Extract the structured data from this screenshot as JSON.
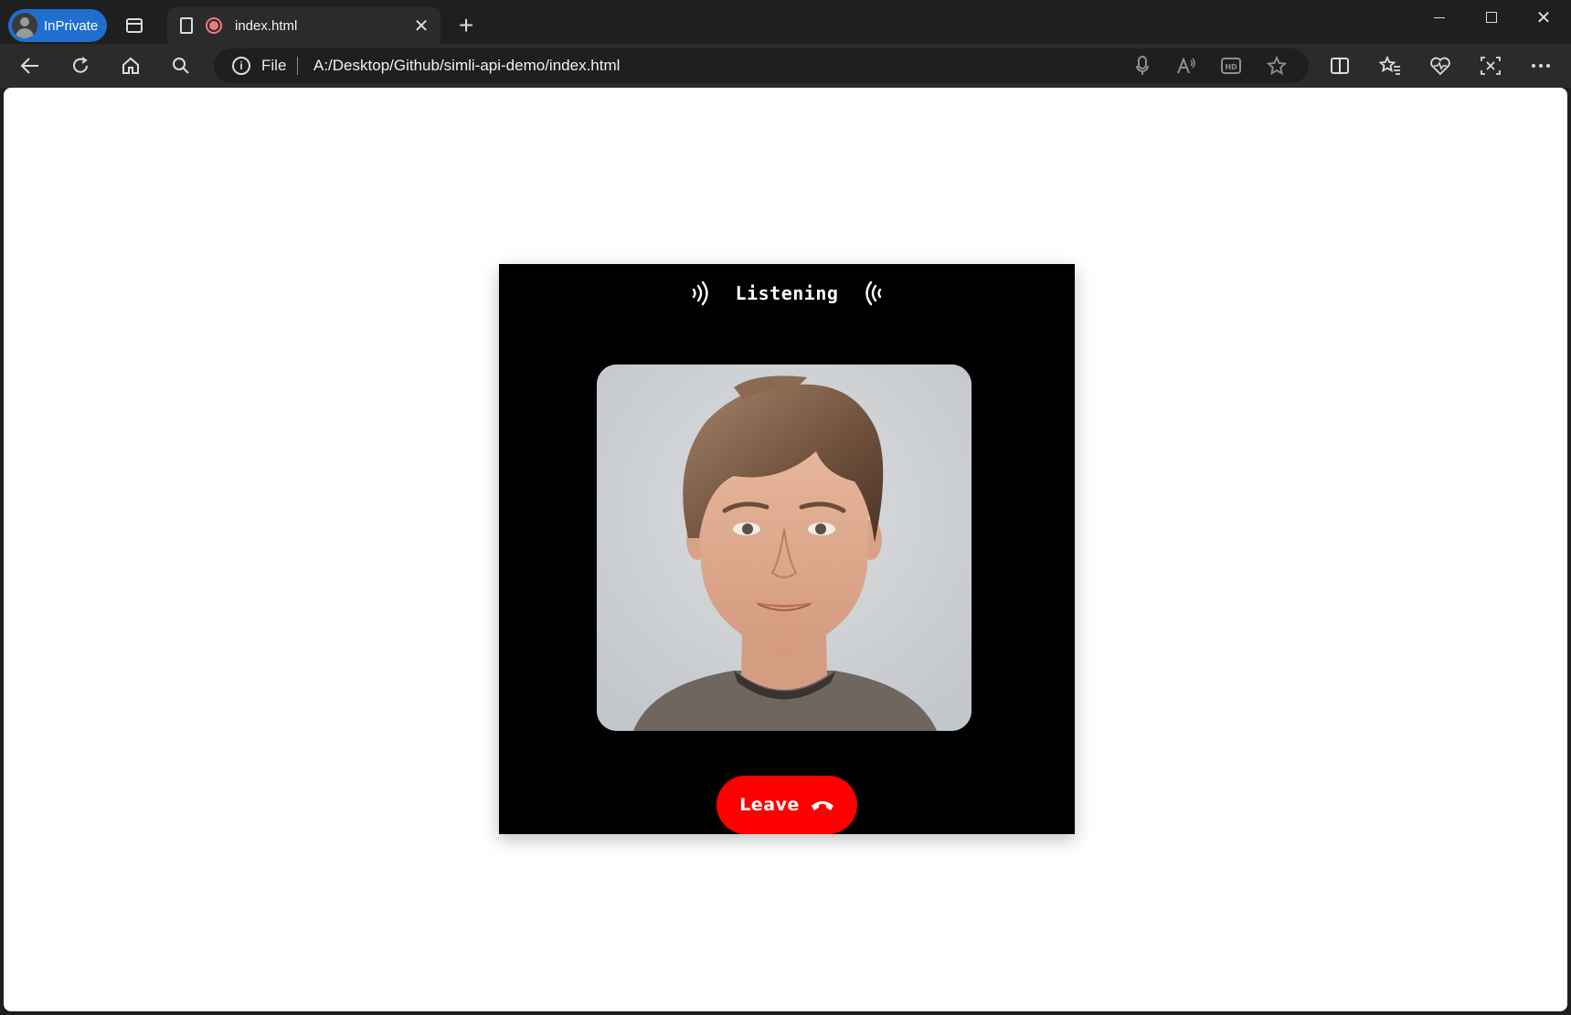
{
  "browser": {
    "profile_label": "InPrivate",
    "tab_title": "index.html",
    "address_scheme": "File",
    "address_url": "A:/Desktop/Github/simli-api-demo/index.html"
  },
  "page": {
    "status_label": "Listening",
    "leave_label": "Leave"
  },
  "colors": {
    "accent_red": "#ff0000",
    "card_background": "#000000",
    "inprivate_blue": "#1f6fcf"
  },
  "icons": [
    "tab-actions-icon",
    "page-icon",
    "recording-icon",
    "close-tab-icon",
    "new-tab-icon",
    "back-icon",
    "refresh-icon",
    "home-icon",
    "search-icon",
    "info-icon",
    "microphone-icon",
    "read-aloud-icon",
    "hd-icon",
    "favorite-star-icon",
    "split-screen-icon",
    "favorites-icon",
    "browser-essentials-icon",
    "screenshot-icon",
    "more-icon",
    "sound-wave-right-icon",
    "sound-wave-left-icon",
    "hang-up-phone-icon"
  ]
}
